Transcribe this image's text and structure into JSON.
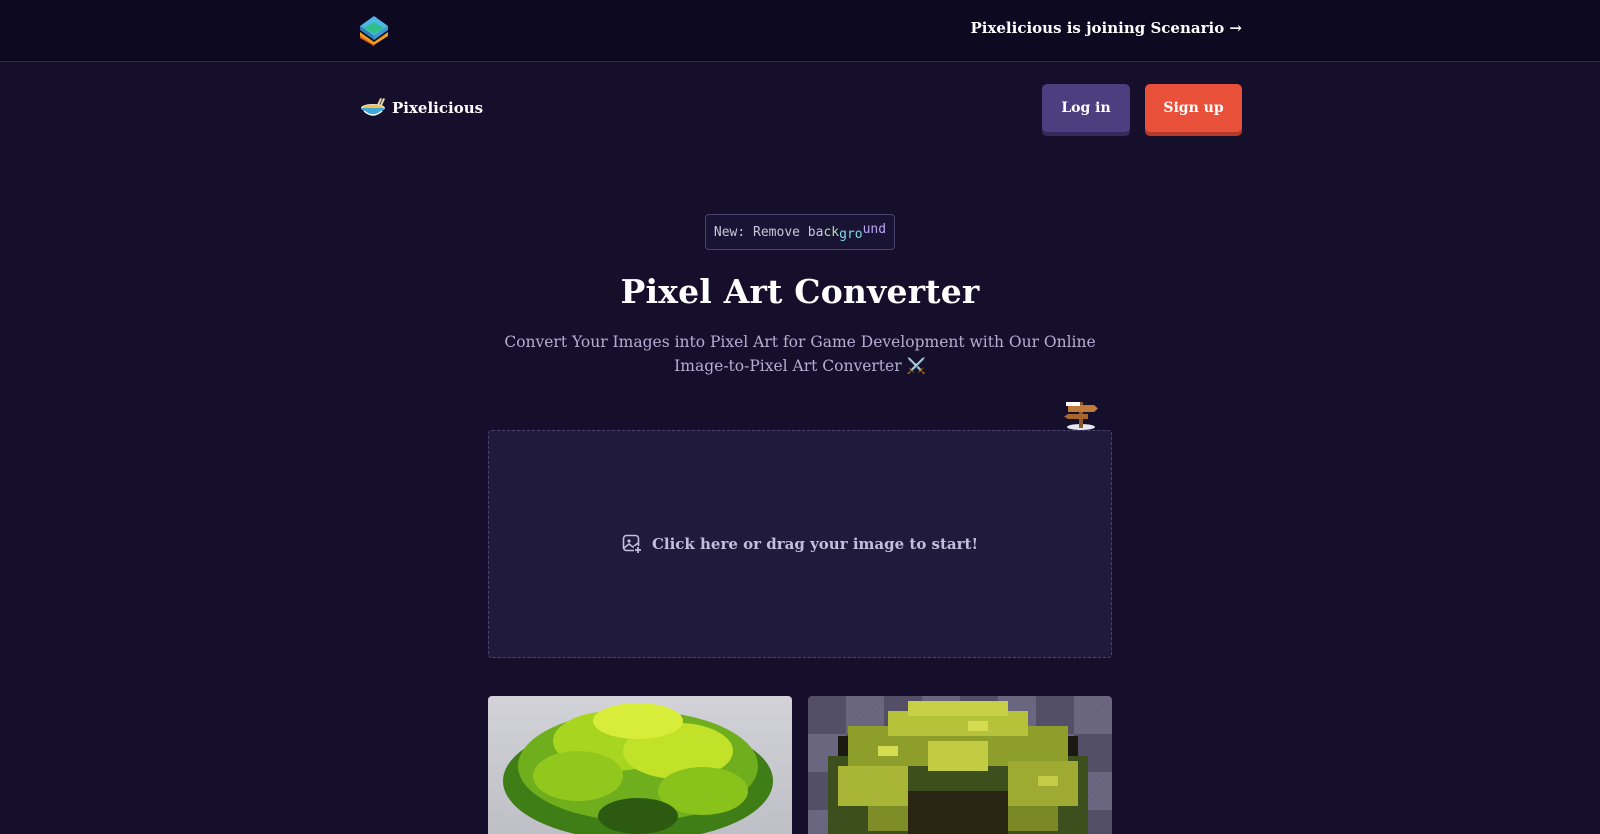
{
  "topbar": {
    "announcement": "Pixelicious is joining Scenario →"
  },
  "header": {
    "brand_name": "Pixelicious",
    "login_label": "Log in",
    "signup_label": "Sign up"
  },
  "badge": {
    "prefix": "New: Remove ba",
    "part1": "ck",
    "part2": "gro",
    "part3": "und"
  },
  "hero": {
    "title": "Pixel Art Converter",
    "subtitle": "Convert Your Images into Pixel Art for Game Development with Our Online Image-to-Pixel Art Converter ⚔️"
  },
  "dropzone": {
    "label": "Click here or drag your image to start!",
    "icon": "image-add-icon"
  },
  "examples": {
    "left_icon": "tree-photo",
    "right_icon": "tree-pixel-art"
  },
  "colors": {
    "background": "#150f2c",
    "topbar": "#0c0920",
    "login_button": "#4c3f80",
    "signup_button": "#e8503a",
    "dropzone": "#201a3d"
  }
}
